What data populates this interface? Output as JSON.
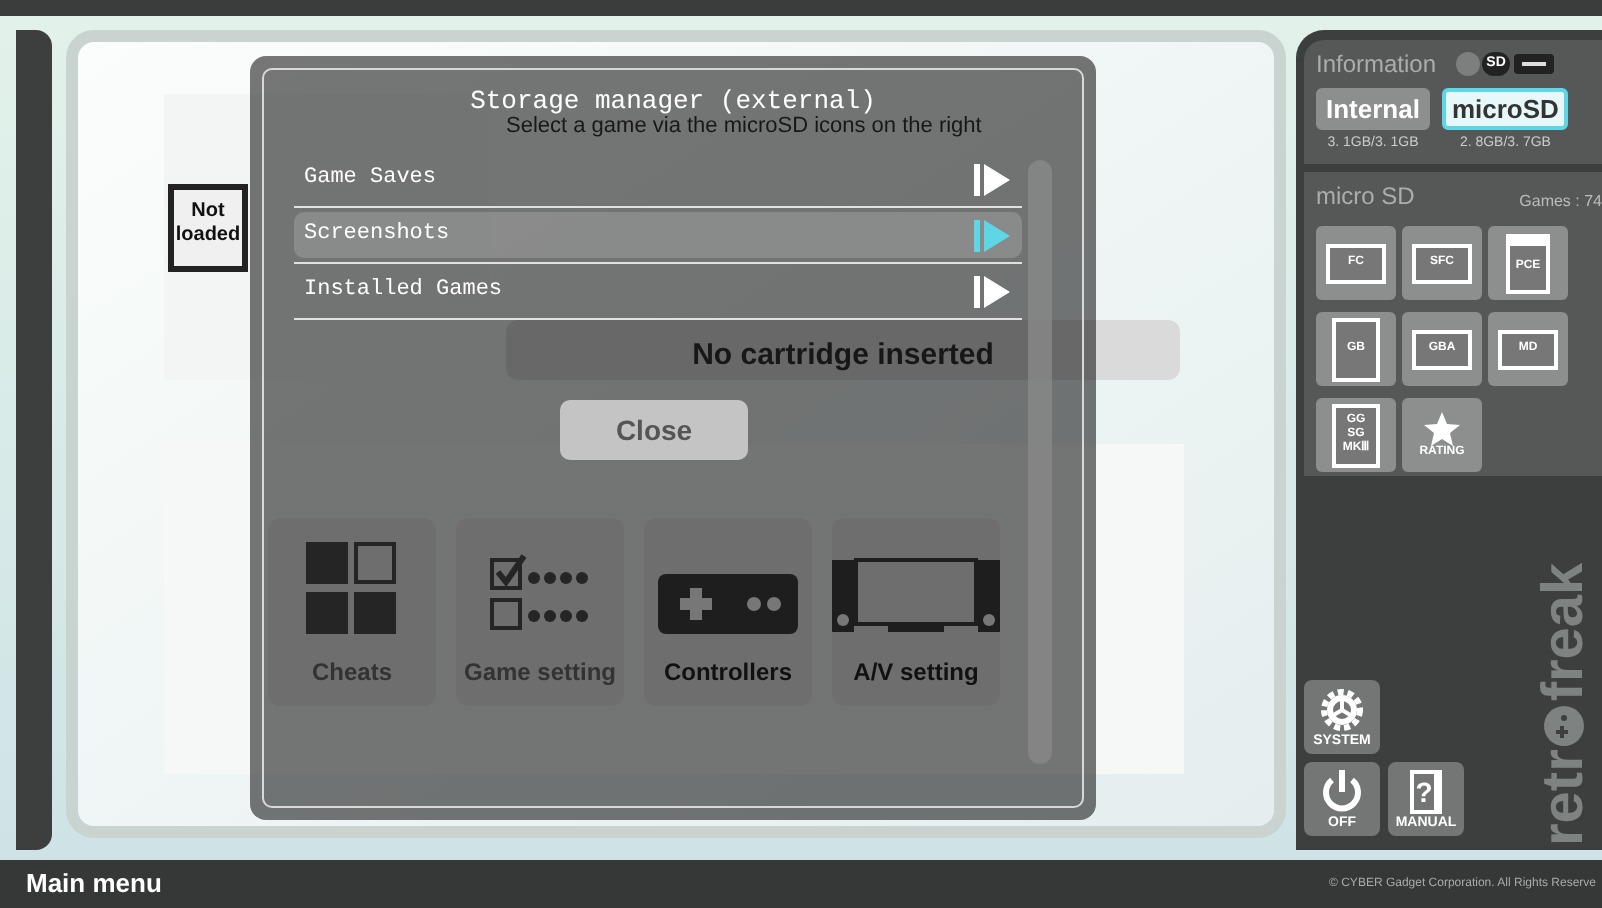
{
  "main": {
    "not_loaded": "Not loaded",
    "hint": "Select a game via the microSD icons on the right",
    "cartridge_status": "No cartridge inserted",
    "menu_tiles": [
      {
        "label": "Cheats",
        "kind": "cheats",
        "disabled": true
      },
      {
        "label": "Game setting",
        "kind": "settings",
        "disabled": true
      },
      {
        "label": "Controllers",
        "kind": "controller",
        "disabled": false
      },
      {
        "label": "A/V setting",
        "kind": "av",
        "disabled": false
      }
    ]
  },
  "dialog": {
    "title": "Storage manager (external)",
    "items": [
      {
        "label": "Game Saves",
        "selected": false
      },
      {
        "label": "Screenshots",
        "selected": true
      },
      {
        "label": "Installed Games",
        "selected": false
      }
    ],
    "close_button": "Close"
  },
  "sidebar": {
    "information": {
      "title": "Information",
      "sd_badge": "SD",
      "storage": [
        {
          "label": "Internal",
          "size": "3. 1GB/3. 1GB",
          "selected": false
        },
        {
          "label": "microSD",
          "size": "2. 8GB/3. 7GB",
          "selected": true
        }
      ]
    },
    "microsd": {
      "title": "micro SD",
      "games": "Games : 74",
      "systems": [
        {
          "label": "FC",
          "kind": "wide"
        },
        {
          "label": "SFC",
          "kind": "wide"
        },
        {
          "label": "PCE",
          "kind": "card"
        },
        {
          "label": "GB",
          "kind": "tall"
        },
        {
          "label": "GBA",
          "kind": "wide"
        },
        {
          "label": "MD",
          "kind": "wide"
        },
        {
          "label": "GG SG MKⅢ",
          "kind": "tall"
        },
        {
          "label": "RATING",
          "kind": "rating"
        }
      ]
    },
    "system_buttons": [
      {
        "label": "SYSTEM",
        "kind": "system"
      },
      {
        "label": "OFF",
        "kind": "power"
      },
      {
        "label": "MANUAL",
        "kind": "manual",
        "glyph": "?"
      }
    ],
    "logo": [
      "retr",
      "freak"
    ]
  },
  "status_bar": {
    "title": "Main menu",
    "copyright": "© CYBER Gadget Corporation. All Rights Reserve"
  }
}
